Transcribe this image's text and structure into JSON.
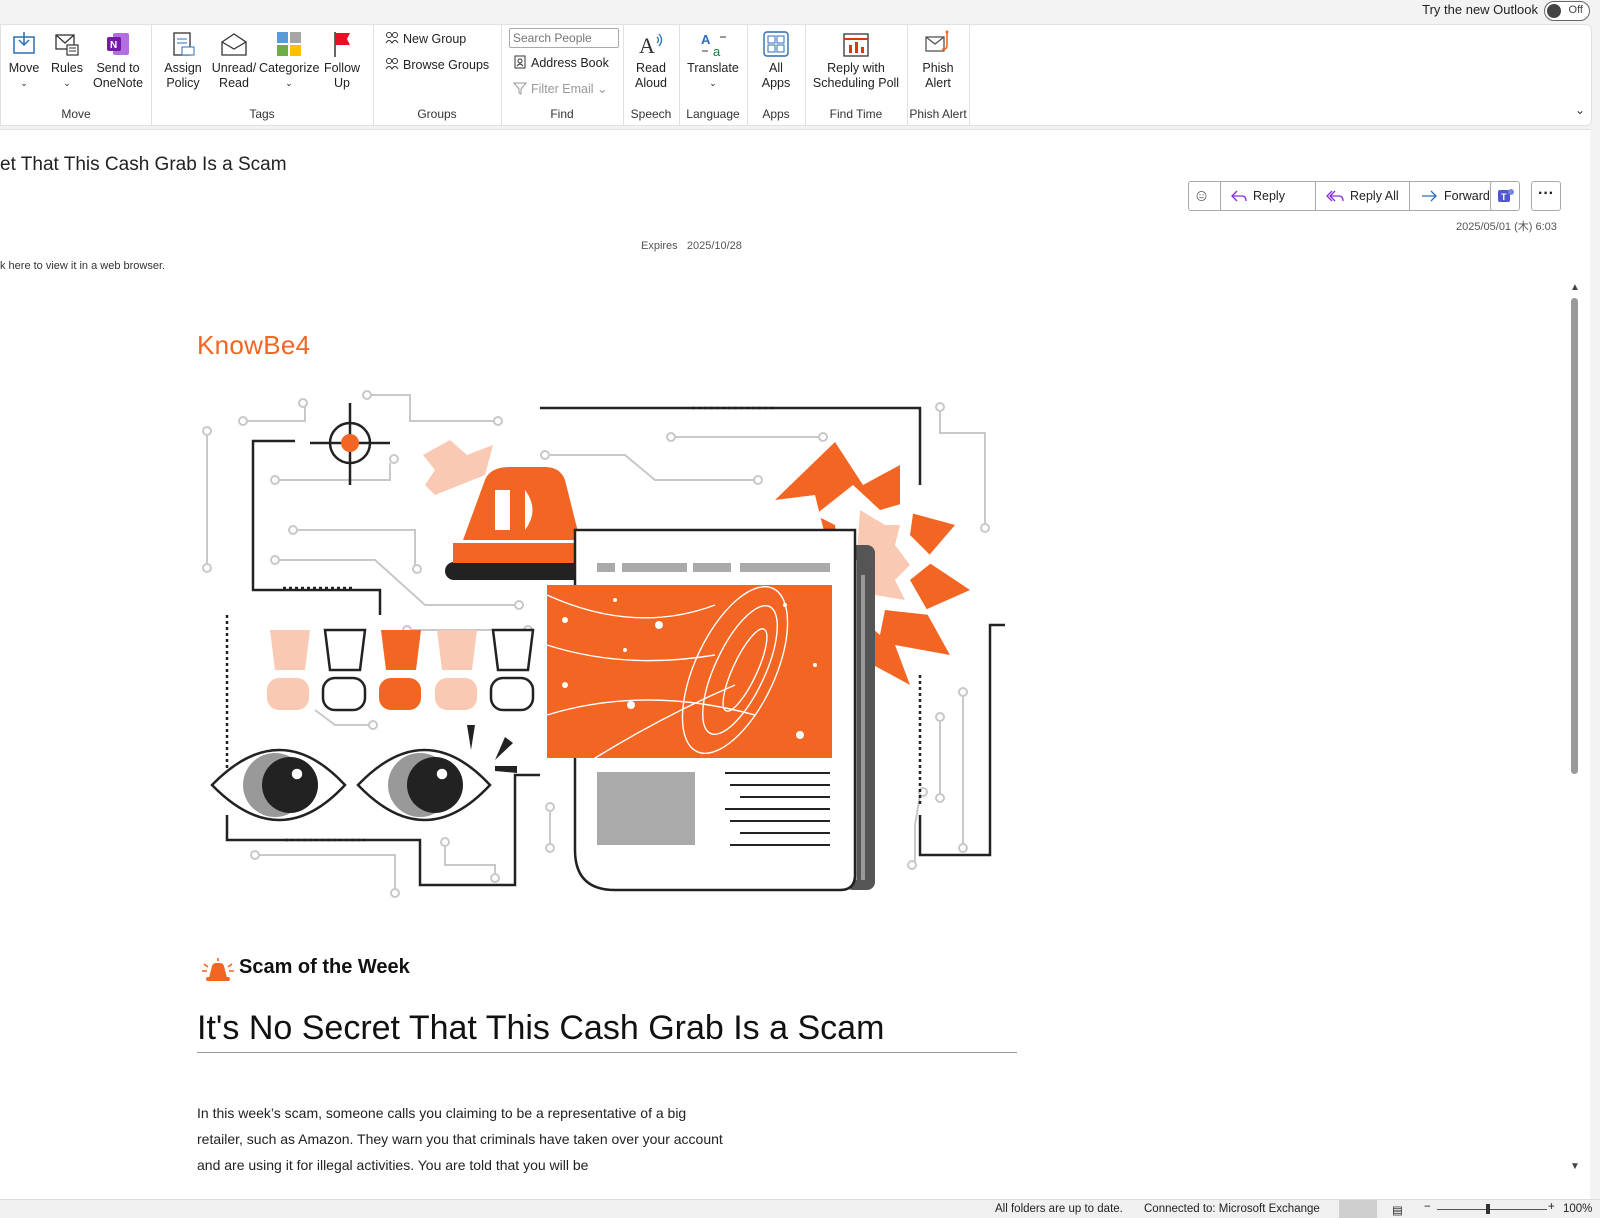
{
  "topbar": {
    "try_new": "Try the new Outlook",
    "toggle": "Off"
  },
  "ribbon": {
    "move": {
      "name": "Move",
      "move_label": "Move",
      "rules_label": "Rules",
      "onenote_label": "Send to OneNote"
    },
    "tags": {
      "name": "Tags",
      "assign_label": "Assign Policy",
      "unread_label": "Unread/ Read",
      "categorize_label": "Categorize",
      "follow_label": "Follow Up"
    },
    "groups": {
      "name": "Groups",
      "new_group": "New Group",
      "browse_groups": "Browse Groups"
    },
    "find": {
      "name": "Find",
      "search_placeholder": "Search People",
      "address_book": "Address Book",
      "filter_email": "Filter Email"
    },
    "speech": {
      "name": "Speech",
      "read_aloud": "Read Aloud"
    },
    "language": {
      "name": "Language",
      "translate": "Translate"
    },
    "apps": {
      "name": "Apps",
      "all_apps": "All Apps"
    },
    "findtime": {
      "name": "Find Time",
      "reply_poll": "Reply with Scheduling Poll"
    },
    "phish": {
      "name": "Phish Alert",
      "phish_alert": "Phish Alert"
    }
  },
  "message": {
    "subject": "et That This Cash Grab Is a Scam",
    "actions": {
      "reply": "Reply",
      "reply_all": "Reply All",
      "forward": "Forward"
    },
    "date": "2025/05/01 (木) 6:03",
    "expires_label": "Expires",
    "expires_date": "2025/10/28",
    "web_view": "k here to view it in a web browser."
  },
  "content": {
    "logo": "KnowBe4",
    "section_label": "Scam of the Week",
    "headline": "It's No Secret That This Cash Grab Is a Scam",
    "body": "In this week’s scam, someone calls you claiming to be a representative of a big retailer, such as Amazon. They warn you that criminals have taken over your account and are using it for illegal activities. You are told that you will be"
  },
  "statusbar": {
    "sync": "All folders are up to date.",
    "connection": "Connected to: Microsoft Exchange",
    "zoom": "100%"
  },
  "colors": {
    "brand_orange": "#f26522",
    "peach": "#f9c9b4",
    "ribbon_border": "#e1e1e1"
  }
}
